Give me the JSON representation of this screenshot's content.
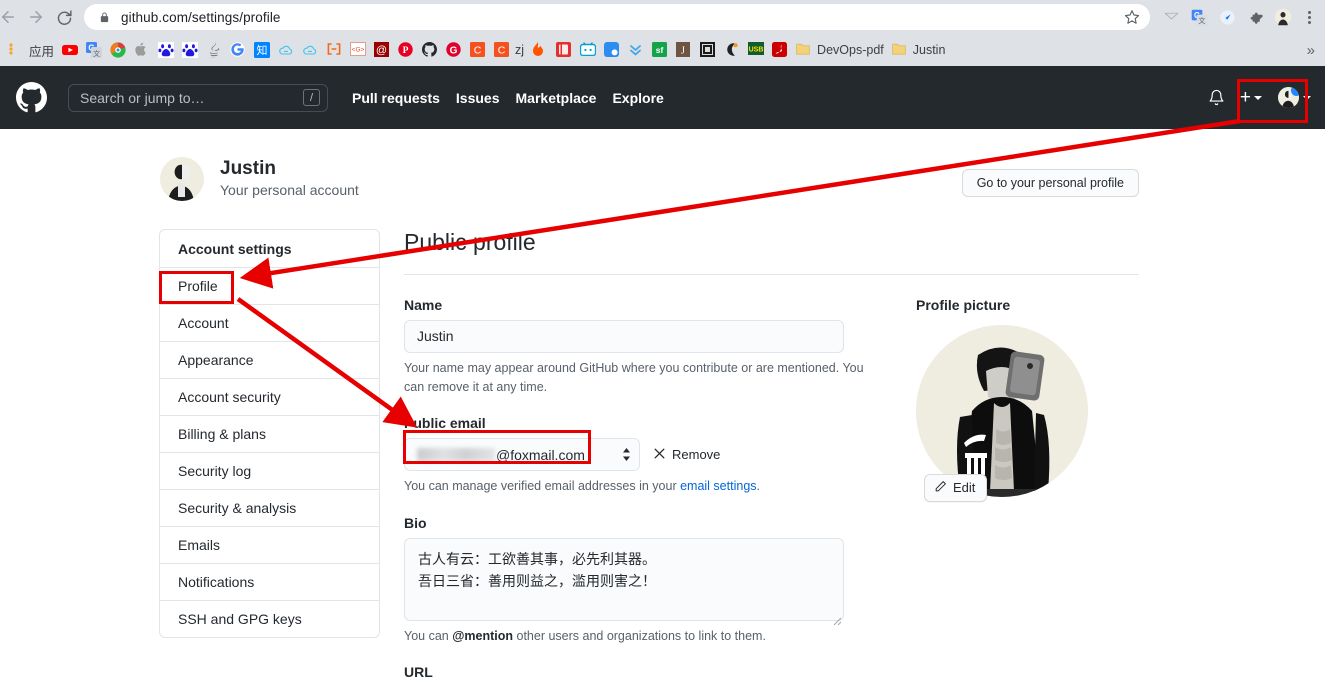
{
  "browser": {
    "url": "github.com/settings/profile",
    "nav": {
      "back": "back-arrow",
      "forward": "forward-arrow",
      "reload": "reload-icon"
    },
    "lock_icon": "lock-icon",
    "star_icon": "bookmark-star-icon",
    "extensions": [
      "pocket-icon",
      "google-translate-icon",
      "rocket-icon",
      "puzzle-extensions-icon",
      "chrome-profile-avatar"
    ],
    "menu": "three-dot-menu-icon",
    "bookmarks": [
      {
        "label": "应用",
        "icon": "apps-grid-icon",
        "color": "#f5a623"
      },
      {
        "label": "",
        "icon": "youtube-icon",
        "color": "#ff0000"
      },
      {
        "label": "",
        "icon": "google-translate-icon",
        "color": "#4285f4"
      },
      {
        "label": "",
        "icon": "360-browser-icon",
        "color": "#2ab84a"
      },
      {
        "label": "",
        "icon": "apple-icon",
        "color": "#999999"
      },
      {
        "label": "",
        "icon": "baidu-icon",
        "color": "#2319dc"
      },
      {
        "label": "",
        "icon": "baidu-icon",
        "color": "#2319dc"
      },
      {
        "label": "",
        "icon": "java-icon",
        "color": "#6d6d6d"
      },
      {
        "label": "",
        "icon": "google-icon",
        "color": "#4285f4"
      },
      {
        "label": "",
        "icon": "zhihu-icon",
        "color": "#0084ff"
      },
      {
        "label": "",
        "icon": "cloud-icon",
        "color": "#3ec6f0"
      },
      {
        "label": "",
        "icon": "cloud-icon",
        "color": "#3ec6f0"
      },
      {
        "label": "",
        "icon": "bracket-link-icon",
        "color": "#f06a1e"
      },
      {
        "label": "",
        "icon": "code-box-icon",
        "color": "#e04a2f"
      },
      {
        "label": "",
        "icon": "at-sign-icon",
        "color": "#b30000"
      },
      {
        "label": "",
        "icon": "pinterest-p-icon",
        "color": "#e60023"
      },
      {
        "label": "",
        "icon": "github-icon",
        "color": "#24292e"
      },
      {
        "label": "",
        "icon": "g-circle-icon",
        "color": "#e0002d"
      },
      {
        "label": "",
        "icon": "c-square-icon",
        "color": "#f4511e"
      },
      {
        "label": "zj",
        "icon": "c-square-icon",
        "color": "#f4511e"
      },
      {
        "label": "",
        "icon": "flame-icon",
        "color": "#ff5500"
      },
      {
        "label": "",
        "icon": "red-book-icon",
        "color": "#e62e2e"
      },
      {
        "label": "",
        "icon": "bilibili-icon",
        "color": "#00a1d6"
      },
      {
        "label": "",
        "icon": "blue-note-icon",
        "color": "#2d8cf0"
      },
      {
        "label": "",
        "icon": "double-chevron-down-icon",
        "color": "#3ba7e8"
      },
      {
        "label": "",
        "icon": "sourceforge-icon",
        "color": "#15a34a"
      },
      {
        "label": "",
        "icon": "j-box-icon",
        "color": "#6d5542"
      },
      {
        "label": "",
        "icon": "dark-grid-icon",
        "color": "#2b2b2b"
      },
      {
        "label": "",
        "icon": "crescent-icon",
        "color": "#f7941e"
      },
      {
        "label": "",
        "icon": "usb-icon",
        "color": "#0e5c2f"
      },
      {
        "label": "",
        "icon": "adobe-reader-icon",
        "color": "#cc0000"
      },
      {
        "label": "DevOps-pdf",
        "icon": "folder-icon",
        "color": "#f3d27a"
      },
      {
        "label": "Justin",
        "icon": "folder-icon",
        "color": "#f3d27a"
      }
    ],
    "bookmarks_overflow": "»"
  },
  "gh_header": {
    "logo_icon": "github-mark-icon",
    "search_placeholder": "Search or jump to…",
    "search_shortcut": "/",
    "nav": [
      "Pull requests",
      "Issues",
      "Marketplace",
      "Explore"
    ],
    "bell_icon": "notification-bell-icon",
    "plus_label": "+",
    "avatar_icon": "user-avatar",
    "unread_dot_color": "#2188ff"
  },
  "profile_header": {
    "name": "Justin",
    "subtitle": "Your personal account",
    "avatar_icon": "user-avatar"
  },
  "personal_profile_button": "Go to your personal profile",
  "sidebar": {
    "heading": "Account settings",
    "items": [
      {
        "label": "Profile"
      },
      {
        "label": "Account"
      },
      {
        "label": "Appearance"
      },
      {
        "label": "Account security"
      },
      {
        "label": "Billing & plans"
      },
      {
        "label": "Security log"
      },
      {
        "label": "Security & analysis"
      },
      {
        "label": "Emails"
      },
      {
        "label": "Notifications"
      },
      {
        "label": "SSH and GPG keys"
      }
    ]
  },
  "main": {
    "title": "Public profile",
    "name": {
      "label": "Name",
      "value": "Justin",
      "help_a": "Your name may appear around GitHub where you contribute or are mentioned. You can remove it at any time."
    },
    "public_email": {
      "label": "Public email",
      "value_suffix": "@foxmail.com",
      "value_redacted": true,
      "stepper_icon": "select-stepper-icon",
      "remove_label": "Remove",
      "remove_icon": "x-close-icon",
      "help_prefix": "You can manage verified email addresses in your ",
      "help_link": "email settings",
      "help_suffix": "."
    },
    "bio": {
      "label": "Bio",
      "line1": "古人有云：工欲善其事，必先利其器。",
      "line2": "吾日三省：善用则益之，滥用则害之！",
      "help_prefix": "You can ",
      "help_mention": "@mention",
      "help_suffix": " other users and organizations to link to them."
    },
    "url": {
      "label": "URL"
    },
    "profile_picture": {
      "label": "Profile picture",
      "edit_label": "Edit",
      "edit_icon": "pencil-icon",
      "image_icon": "user-photo"
    }
  },
  "annotations": {
    "highlight_color": "#e60000",
    "boxes": [
      "avatar-menu",
      "sidebar-profile-item",
      "public-email-select"
    ],
    "arrows": [
      "avatar-to-profile",
      "profile-to-public-email"
    ]
  }
}
